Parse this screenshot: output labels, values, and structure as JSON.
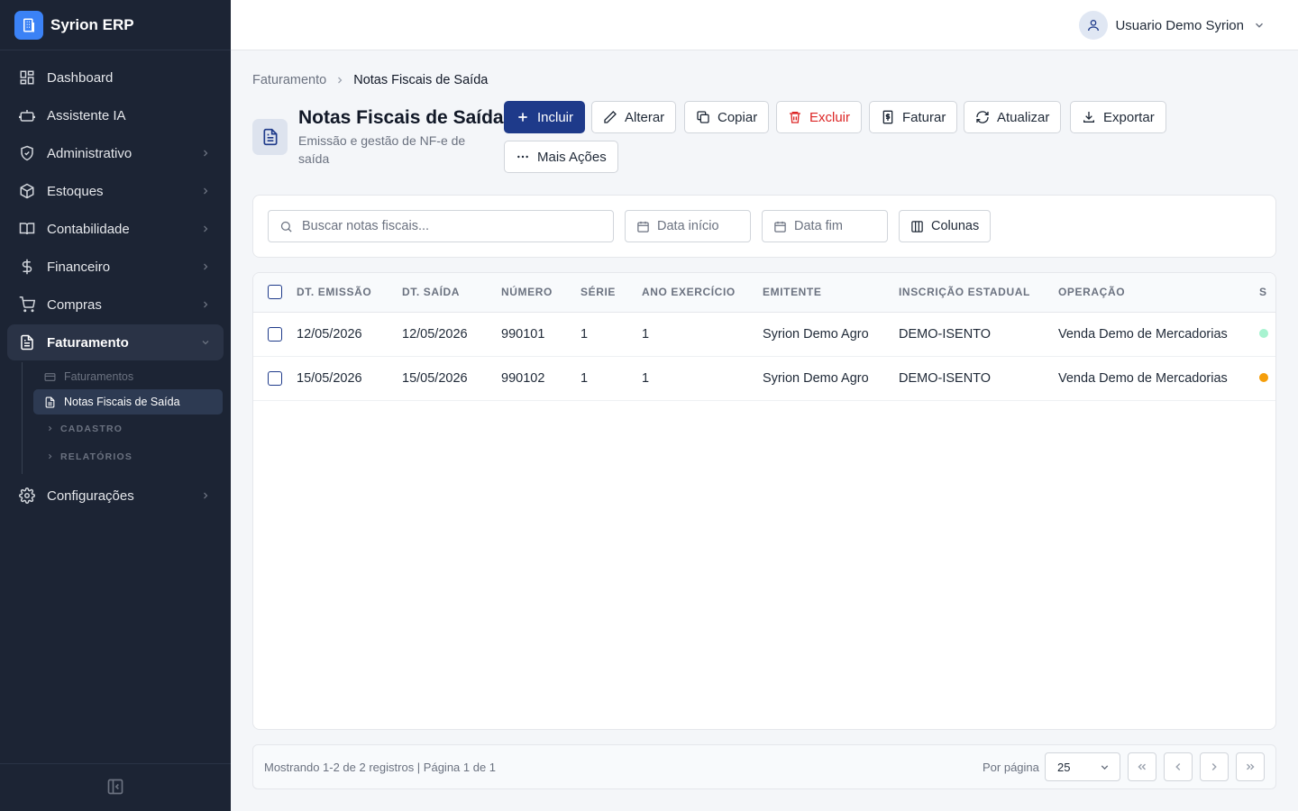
{
  "app": {
    "name": "Syrion ERP"
  },
  "sidebar": {
    "items": [
      {
        "label": "Dashboard",
        "icon": "dashboard-icon"
      },
      {
        "label": "Assistente IA",
        "icon": "bot-icon"
      },
      {
        "label": "Administrativo",
        "icon": "shield-icon"
      },
      {
        "label": "Estoques",
        "icon": "package-icon"
      },
      {
        "label": "Contabilidade",
        "icon": "book-icon"
      },
      {
        "label": "Financeiro",
        "icon": "dollar-icon"
      },
      {
        "label": "Compras",
        "icon": "cart-icon"
      },
      {
        "label": "Faturamento",
        "icon": "document-icon"
      },
      {
        "label": "Configurações",
        "icon": "gear-icon"
      }
    ],
    "faturamento_sub": {
      "items": [
        {
          "label": "Faturamentos",
          "icon": "card-icon"
        },
        {
          "label": "Notas Fiscais de Saída",
          "icon": "document-icon"
        }
      ],
      "groups": [
        "CADASTRO",
        "RELATÓRIOS"
      ]
    }
  },
  "header": {
    "user_name": "Usuario Demo Syrion"
  },
  "breadcrumb": [
    "Faturamento",
    "Notas Fiscais de Saída"
  ],
  "page": {
    "title": "Notas Fiscais de Saída",
    "subtitle": "Emissão e gestão de NF-e de saída"
  },
  "toolbar": {
    "incluir": "Incluir",
    "alterar": "Alterar",
    "copiar": "Copiar",
    "excluir": "Excluir",
    "faturar": "Faturar",
    "atualizar": "Atualizar",
    "exportar": "Exportar",
    "mais_acoes": "Mais Ações"
  },
  "filters": {
    "search_placeholder": "Buscar notas fiscais...",
    "date_start_placeholder": "Data início",
    "date_end_placeholder": "Data fim",
    "columns_label": "Colunas"
  },
  "table": {
    "headers": [
      "DT. EMISSÃO",
      "DT. SAÍDA",
      "NÚMERO",
      "SÉRIE",
      "ANO EXERCÍCIO",
      "EMITENTE",
      "INSCRIÇÃO ESTADUAL",
      "OPERAÇÃO",
      "S"
    ],
    "rows": [
      {
        "dt_emissao": "12/05/2026",
        "dt_saida": "12/05/2026",
        "numero": "990101",
        "serie": "1",
        "ano": "1",
        "emitente": "Syrion Demo Agro",
        "ie": "DEMO-ISENTO",
        "operacao": "Venda Demo de Mercadorias",
        "status_color": "#a7f3d0"
      },
      {
        "dt_emissao": "15/05/2026",
        "dt_saida": "15/05/2026",
        "numero": "990102",
        "serie": "1",
        "ano": "1",
        "emitente": "Syrion Demo Agro",
        "ie": "DEMO-ISENTO",
        "operacao": "Venda Demo de Mercadorias",
        "status_color": "#f59e0b"
      }
    ]
  },
  "pagination": {
    "records_text": "Mostrando 1-2 de 2 registros | Página 1 de 1",
    "per_page_label": "Por página",
    "per_page_value": "25"
  },
  "colors": {
    "sidebar_bg": "#1c2434",
    "primary": "#1e3a8a",
    "danger": "#dc2626",
    "brand": "#3b82f6"
  }
}
